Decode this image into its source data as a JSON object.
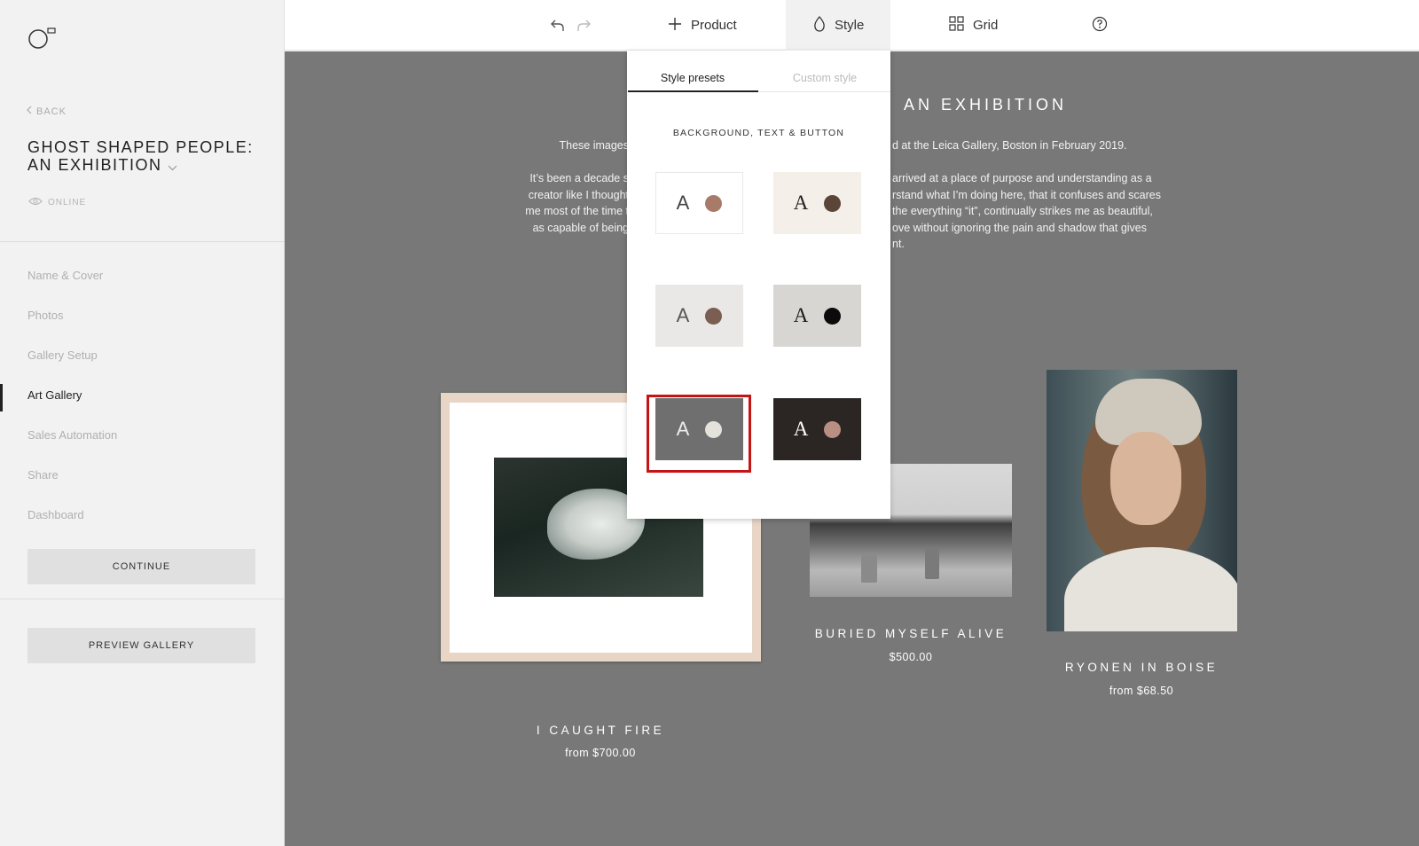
{
  "sidebar": {
    "logo": "brand-logo-icon",
    "back_label": "BACK",
    "gallery_title": "GHOST SHAPED PEOPLE: AN EXHIBITION",
    "status": "ONLINE",
    "nav_items": [
      {
        "label": "Name & Cover",
        "active": false
      },
      {
        "label": "Photos",
        "active": false
      },
      {
        "label": "Gallery Setup",
        "active": false
      },
      {
        "label": "Art Gallery",
        "active": true
      },
      {
        "label": "Sales Automation",
        "active": false
      },
      {
        "label": "Share",
        "active": false
      },
      {
        "label": "Dashboard",
        "active": false
      }
    ],
    "continue_label": "CONTINUE",
    "preview_label": "PREVIEW GALLERY"
  },
  "toolbar": {
    "undo_icon": "undo-icon",
    "redo_icon": "redo-icon",
    "product_label": "Product",
    "style_label": "Style",
    "grid_label": "Grid",
    "help_icon": "help-icon"
  },
  "canvas": {
    "exhibition_title": "AN EXHIBITION",
    "desc_left": [
      "These images",
      "It’s been a decade s",
      "creator like I thought",
      "me most of the time t",
      "as capable of being"
    ],
    "desc_right": [
      "d at the Leica Gallery, Boston in February 2019.",
      "arrived at a place of purpose and understanding as a",
      "rstand what I’m doing here, that it confuses and scares",
      "the everything “it”, continually strikes me as beautiful,",
      "ove without ignoring the pain and shadow that gives",
      "nt."
    ],
    "background_color": "#777877",
    "products": [
      {
        "title": "I CAUGHT FIRE",
        "price": "from $700.00"
      },
      {
        "title": "BURIED MYSELF ALIVE",
        "price": "$500.00"
      },
      {
        "title": "RYONEN IN BOISE",
        "price": "from $68.50"
      }
    ]
  },
  "style_panel": {
    "tabs": [
      {
        "label": "Style presets",
        "active": true
      },
      {
        "label": "Custom style",
        "active": false
      }
    ],
    "section_label": "BACKGROUND, TEXT & BUTTON",
    "presets": [
      {
        "letter": "A",
        "bg": "#ffffff",
        "text": "#444444",
        "button": "#a87a68",
        "serif": false,
        "selected": false
      },
      {
        "letter": "A",
        "bg": "#f4efe9",
        "text": "#1f1f1f",
        "button": "#5b4438",
        "serif": true,
        "selected": false
      },
      {
        "letter": "A",
        "bg": "#eae8e6",
        "text": "#555555",
        "button": "#7a5e52",
        "serif": false,
        "selected": false
      },
      {
        "letter": "A",
        "bg": "#d7d6d3",
        "text": "#1b1b1b",
        "button": "#0b0b0b",
        "serif": true,
        "selected": false
      },
      {
        "letter": "A",
        "bg": "#6e6f6e",
        "text": "#eeeeee",
        "button": "#e3e3dc",
        "serif": false,
        "selected": true
      },
      {
        "letter": "A",
        "bg": "#2b2624",
        "text": "#ffffff",
        "button": "#b88f82",
        "serif": true,
        "selected": false
      }
    ],
    "selection_color": "#c51414"
  }
}
